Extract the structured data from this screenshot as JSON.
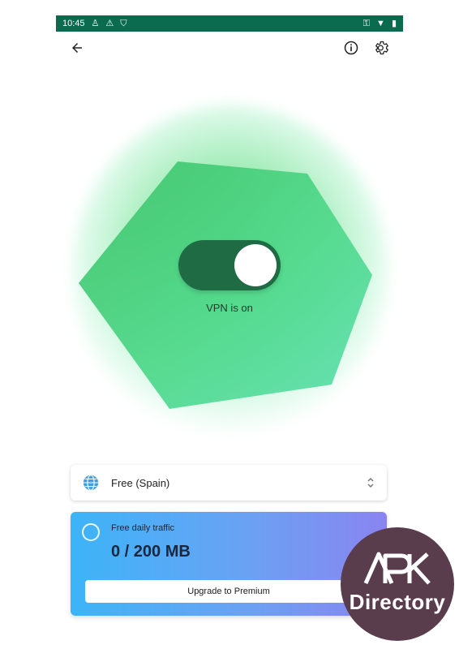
{
  "status_bar": {
    "time": "10:45",
    "left_icons": [
      "accessibility-icon",
      "warning-icon",
      "shield-icon"
    ],
    "right_icons": [
      "key-icon",
      "wifi-icon",
      "battery-icon"
    ],
    "background": "#0a6b4f"
  },
  "app_bar": {
    "icons": [
      "back-arrow-icon",
      "info-icon",
      "settings-icon"
    ]
  },
  "vpn": {
    "toggle_on": true,
    "status_text": "VPN is on",
    "toggle_color": "#1f6b43",
    "blob_color": "#4fd38a"
  },
  "location": {
    "label": "Free (Spain)",
    "icon": "globe-icon",
    "chevron": "chevron-up-down-icon"
  },
  "traffic": {
    "title": "Free daily traffic",
    "value": "0 / 200 MB",
    "button_label": "Upgrade to Premium",
    "gradient_start": "#3cb4f8",
    "gradient_end": "#8a84f0"
  },
  "watermark": {
    "text": "Directory",
    "logo_text": "APK",
    "background": "#5a3d4d"
  }
}
